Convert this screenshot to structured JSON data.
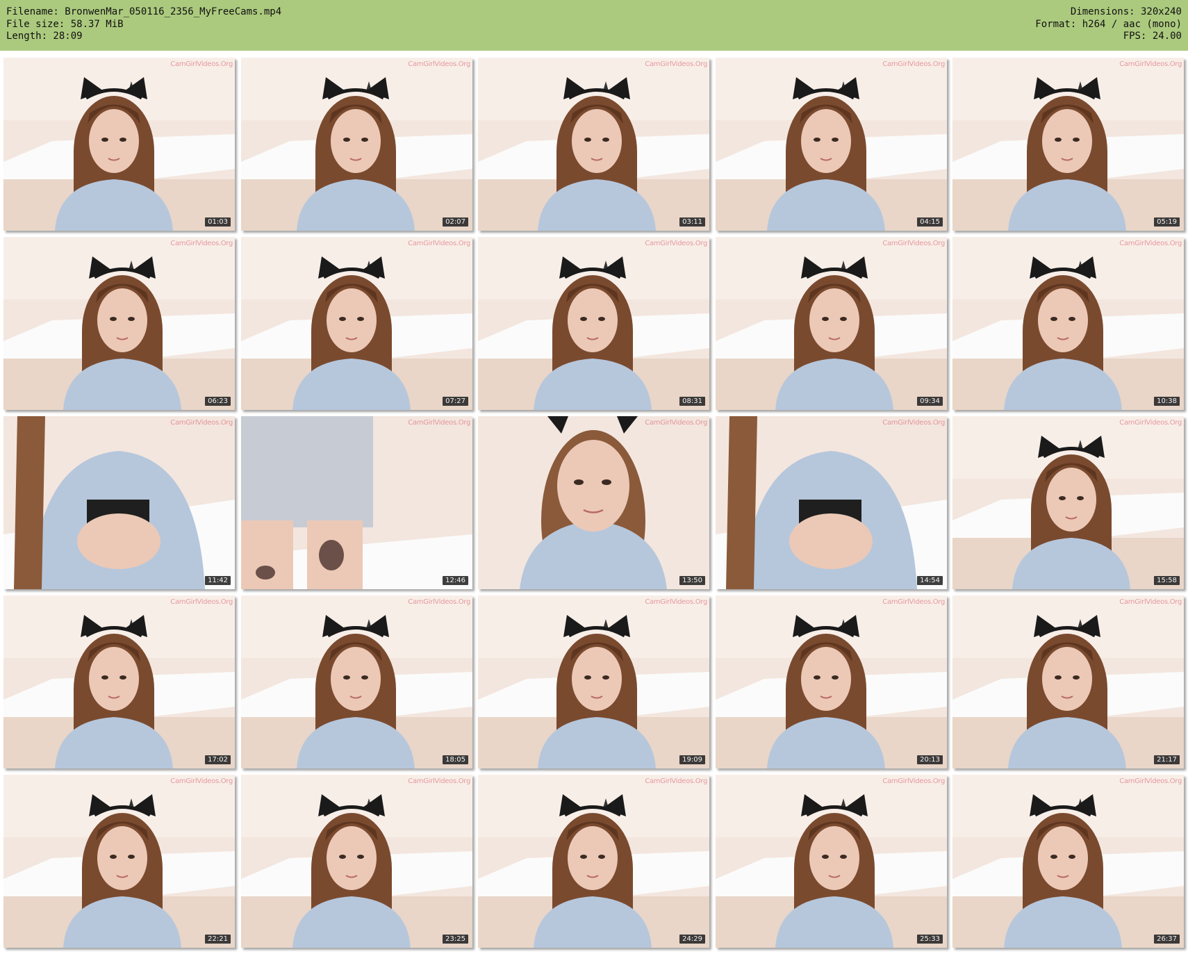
{
  "header": {
    "left": [
      "Filename: BronwenMar_050116_2356_MyFreeCams.mp4",
      "File size: 58.37 MiB",
      "Length: 28:09"
    ],
    "right": [
      "Dimensions: 320x240",
      "Format: h264 / aac (mono)",
      "FPS: 24.00"
    ],
    "background_color": "#acca7e"
  },
  "watermark_text": "CamGirlVideos.Org",
  "thumbnails": [
    {
      "time": "01:03",
      "scene": "portrait"
    },
    {
      "time": "02:07",
      "scene": "portrait"
    },
    {
      "time": "03:11",
      "scene": "portrait"
    },
    {
      "time": "04:15",
      "scene": "portrait"
    },
    {
      "time": "05:19",
      "scene": "portrait"
    },
    {
      "time": "06:23",
      "scene": "portrait"
    },
    {
      "time": "07:27",
      "scene": "portrait"
    },
    {
      "time": "08:31",
      "scene": "portrait"
    },
    {
      "time": "09:34",
      "scene": "portrait"
    },
    {
      "time": "10:38",
      "scene": "portrait"
    },
    {
      "time": "11:42",
      "scene": "torso"
    },
    {
      "time": "12:46",
      "scene": "legs"
    },
    {
      "time": "13:50",
      "scene": "closeup"
    },
    {
      "time": "14:54",
      "scene": "torso"
    },
    {
      "time": "15:58",
      "scene": "portrait"
    },
    {
      "time": "17:02",
      "scene": "portrait"
    },
    {
      "time": "18:05",
      "scene": "portrait"
    },
    {
      "time": "19:09",
      "scene": "portrait"
    },
    {
      "time": "20:13",
      "scene": "portrait"
    },
    {
      "time": "21:17",
      "scene": "portrait"
    },
    {
      "time": "22:21",
      "scene": "portrait"
    },
    {
      "time": "23:25",
      "scene": "portrait"
    },
    {
      "time": "24:29",
      "scene": "portrait"
    },
    {
      "time": "25:33",
      "scene": "portrait"
    },
    {
      "time": "26:37",
      "scene": "portrait"
    }
  ]
}
